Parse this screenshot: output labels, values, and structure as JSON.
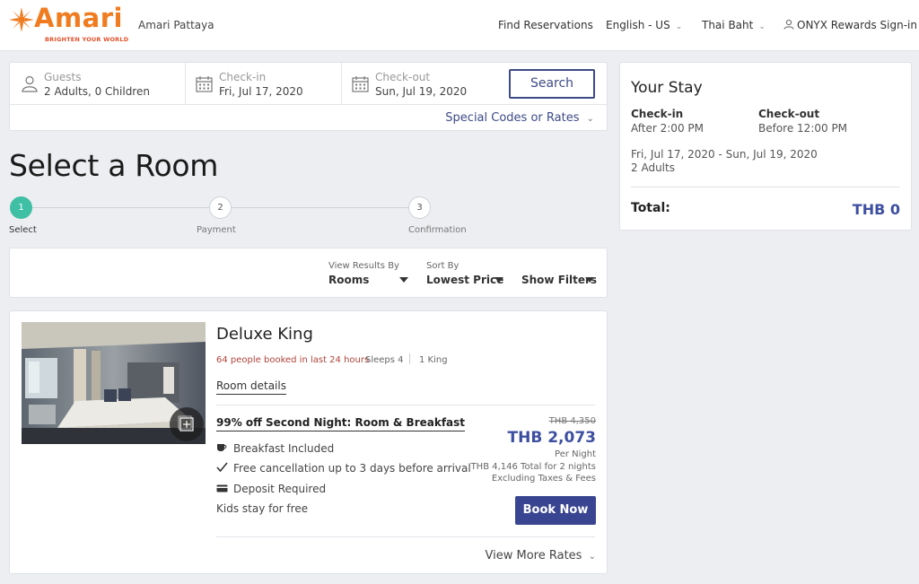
{
  "header": {
    "logo_text": "Amari",
    "logo_tagline": "BRIGHTEN YOUR WORLD",
    "hotel_name": "Amari Pattaya",
    "nav": {
      "find_reservations": "Find Reservations",
      "language": "English - US",
      "currency": "Thai Baht",
      "rewards": "ONYX Rewards Sign-in"
    }
  },
  "search": {
    "guests_label": "Guests",
    "guests_value": "2 Adults, 0 Children",
    "checkin_label": "Check-in",
    "checkin_value": "Fri, Jul 17, 2020",
    "checkout_label": "Check-out",
    "checkout_value": "Sun, Jul 19, 2020",
    "search_button": "Search",
    "special_codes": "Special Codes or Rates"
  },
  "page_title": "Select a Room",
  "steps": [
    {
      "number": "1",
      "label": "Select",
      "active": true
    },
    {
      "number": "2",
      "label": "Payment",
      "active": false
    },
    {
      "number": "3",
      "label": "Confirmation",
      "active": false
    }
  ],
  "sort_bar": {
    "view_label": "View Results By",
    "view_value": "Rooms",
    "sort_label": "Sort By",
    "sort_value": "Lowest Price",
    "filters": "Show Filters"
  },
  "room": {
    "name": "Deluxe King",
    "booked_notice": "64 people booked in last 24 hours",
    "sleeps": "Sleeps 4",
    "bed": "1 King",
    "details_link": "Room details",
    "rate_name": "99% off Second Night: Room & Breakfast",
    "amenities": [
      {
        "icon": "coffee-cup-icon",
        "text": "Breakfast Included"
      },
      {
        "icon": "checkmark-icon",
        "text": "Free cancellation up to 3 days before arrival"
      },
      {
        "icon": "credit-card-icon",
        "text": "Deposit Required"
      },
      {
        "icon": "",
        "text": "Kids stay for free"
      }
    ],
    "price_old": "THB 4,350",
    "price_new": "THB 2,073",
    "per_night": "Per Night",
    "total_note": "THB 4,146 Total for 2 nights",
    "tax_note": "Excluding Taxes & Fees",
    "book_button": "Book Now",
    "more_rates": "View More Rates"
  },
  "stay": {
    "title": "Your Stay",
    "checkin_label": "Check-in",
    "checkin_value": "After 2:00 PM",
    "checkout_label": "Check-out",
    "checkout_value": "Before 12:00 PM",
    "dates": "Fri, Jul 17, 2020 - Sun, Jul 19, 2020",
    "guests": "2 Adults",
    "total_label": "Total:",
    "total_value": "THB 0"
  },
  "colors": {
    "brand_orange": "#f07c21",
    "primary_blue": "#3d4a87",
    "step_active": "#3fbfa4",
    "booked_red": "#b0443a"
  }
}
